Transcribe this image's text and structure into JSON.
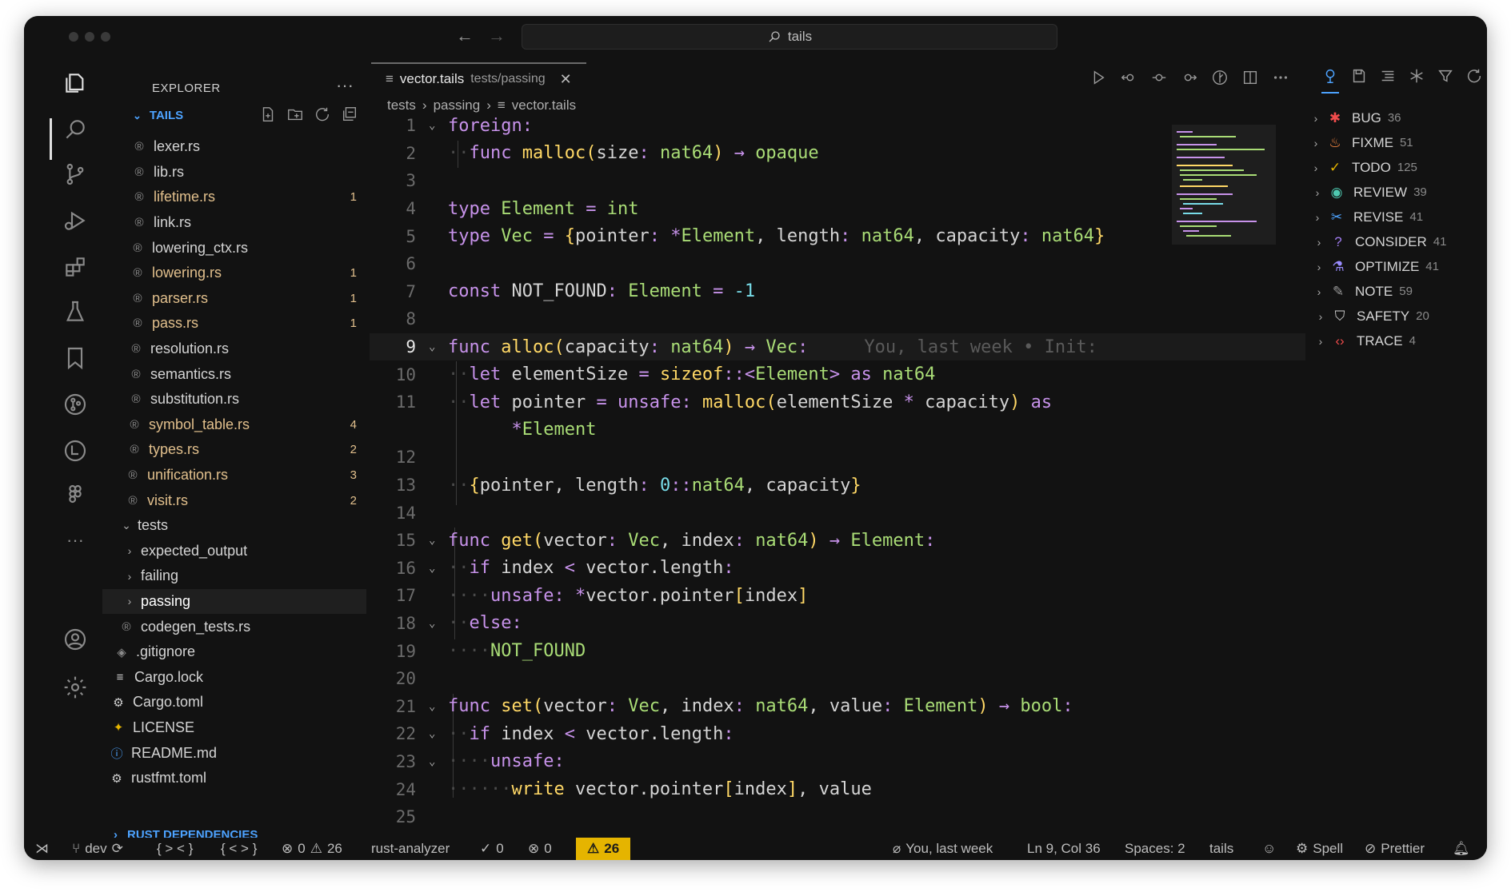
{
  "titlebar": {
    "search": "tails"
  },
  "sidebar": {
    "title": "EXPLORER",
    "section": "TAILS",
    "deps_section": "RUST DEPENDENCIES",
    "items": [
      {
        "name": "lexer.rs",
        "modified": false,
        "badge": ""
      },
      {
        "name": "lib.rs",
        "modified": false,
        "badge": ""
      },
      {
        "name": "lifetime.rs",
        "modified": true,
        "badge": "1"
      },
      {
        "name": "link.rs",
        "modified": false,
        "badge": ""
      },
      {
        "name": "lowering_ctx.rs",
        "modified": false,
        "badge": ""
      },
      {
        "name": "lowering.rs",
        "modified": true,
        "badge": "1"
      },
      {
        "name": "parser.rs",
        "modified": true,
        "badge": "1"
      },
      {
        "name": "pass.rs",
        "modified": true,
        "badge": "1"
      },
      {
        "name": "resolution.rs",
        "modified": false,
        "badge": ""
      },
      {
        "name": "semantics.rs",
        "modified": false,
        "badge": ""
      },
      {
        "name": "substitution.rs",
        "modified": false,
        "badge": ""
      },
      {
        "name": "symbol_table.rs",
        "modified": true,
        "badge": "4"
      },
      {
        "name": "types.rs",
        "modified": true,
        "badge": "2"
      },
      {
        "name": "unification.rs",
        "modified": true,
        "badge": "3"
      },
      {
        "name": "visit.rs",
        "modified": true,
        "badge": "2"
      }
    ],
    "folders": {
      "tests": "tests",
      "expected_output": "expected_output",
      "failing": "failing",
      "passing": "passing"
    },
    "root_files": {
      "codegen": "codegen_tests.rs",
      "gitignore": ".gitignore",
      "cargo_lock": "Cargo.lock",
      "cargo_toml": "Cargo.toml",
      "license": "LICENSE",
      "readme": "README.md",
      "rustfmt": "rustfmt.toml"
    }
  },
  "editor": {
    "tab_name": "vector.tails",
    "tab_path": "tests/passing",
    "breadcrumbs": [
      "tests",
      "passing",
      "vector.tails"
    ],
    "blame": "You, last week • Init:",
    "line_numbers": [
      "1",
      "2",
      "3",
      "4",
      "5",
      "6",
      "7",
      "8",
      "9",
      "10",
      "11",
      "",
      "12",
      "13",
      "14",
      "15",
      "16",
      "17",
      "18",
      "19",
      "20",
      "21",
      "22",
      "23",
      "24",
      "25"
    ]
  },
  "todo": [
    {
      "label": "BUG",
      "count": "36",
      "icon": "bug-icon",
      "color": "#f14c4c"
    },
    {
      "label": "FIXME",
      "count": "51",
      "icon": "flame-icon",
      "color": "#ff8c42"
    },
    {
      "label": "TODO",
      "count": "125",
      "icon": "check-circle-icon",
      "color": "#e5b400"
    },
    {
      "label": "REVIEW",
      "count": "39",
      "icon": "eye-icon",
      "color": "#4ec9b0"
    },
    {
      "label": "REVISE",
      "count": "41",
      "icon": "tools-icon",
      "color": "#4da3ff"
    },
    {
      "label": "CONSIDER",
      "count": "41",
      "icon": "question-icon",
      "color": "#a07cf0"
    },
    {
      "label": "OPTIMIZE",
      "count": "41",
      "icon": "flask-icon",
      "color": "#9a8cff"
    },
    {
      "label": "NOTE",
      "count": "59",
      "icon": "pencil-icon",
      "color": "#9a9a9a"
    },
    {
      "label": "SAFETY",
      "count": "20",
      "icon": "shield-icon",
      "color": "#d4d4d4"
    },
    {
      "label": "TRACE",
      "count": "4",
      "icon": "code-icon",
      "color": "#f14c4c"
    }
  ],
  "status": {
    "branch": "dev",
    "braces1": "{ > < }",
    "braces2": "{ < > }",
    "errors": "0",
    "warnings": "26",
    "analyzer": "rust-analyzer",
    "checks": "0",
    "errors2": "0",
    "warn_badge": "26",
    "blame": "You, last week",
    "position": "Ln 9, Col 36",
    "spaces": "Spaces: 2",
    "language": "tails",
    "spell": "Spell",
    "prettier": "Prettier"
  }
}
